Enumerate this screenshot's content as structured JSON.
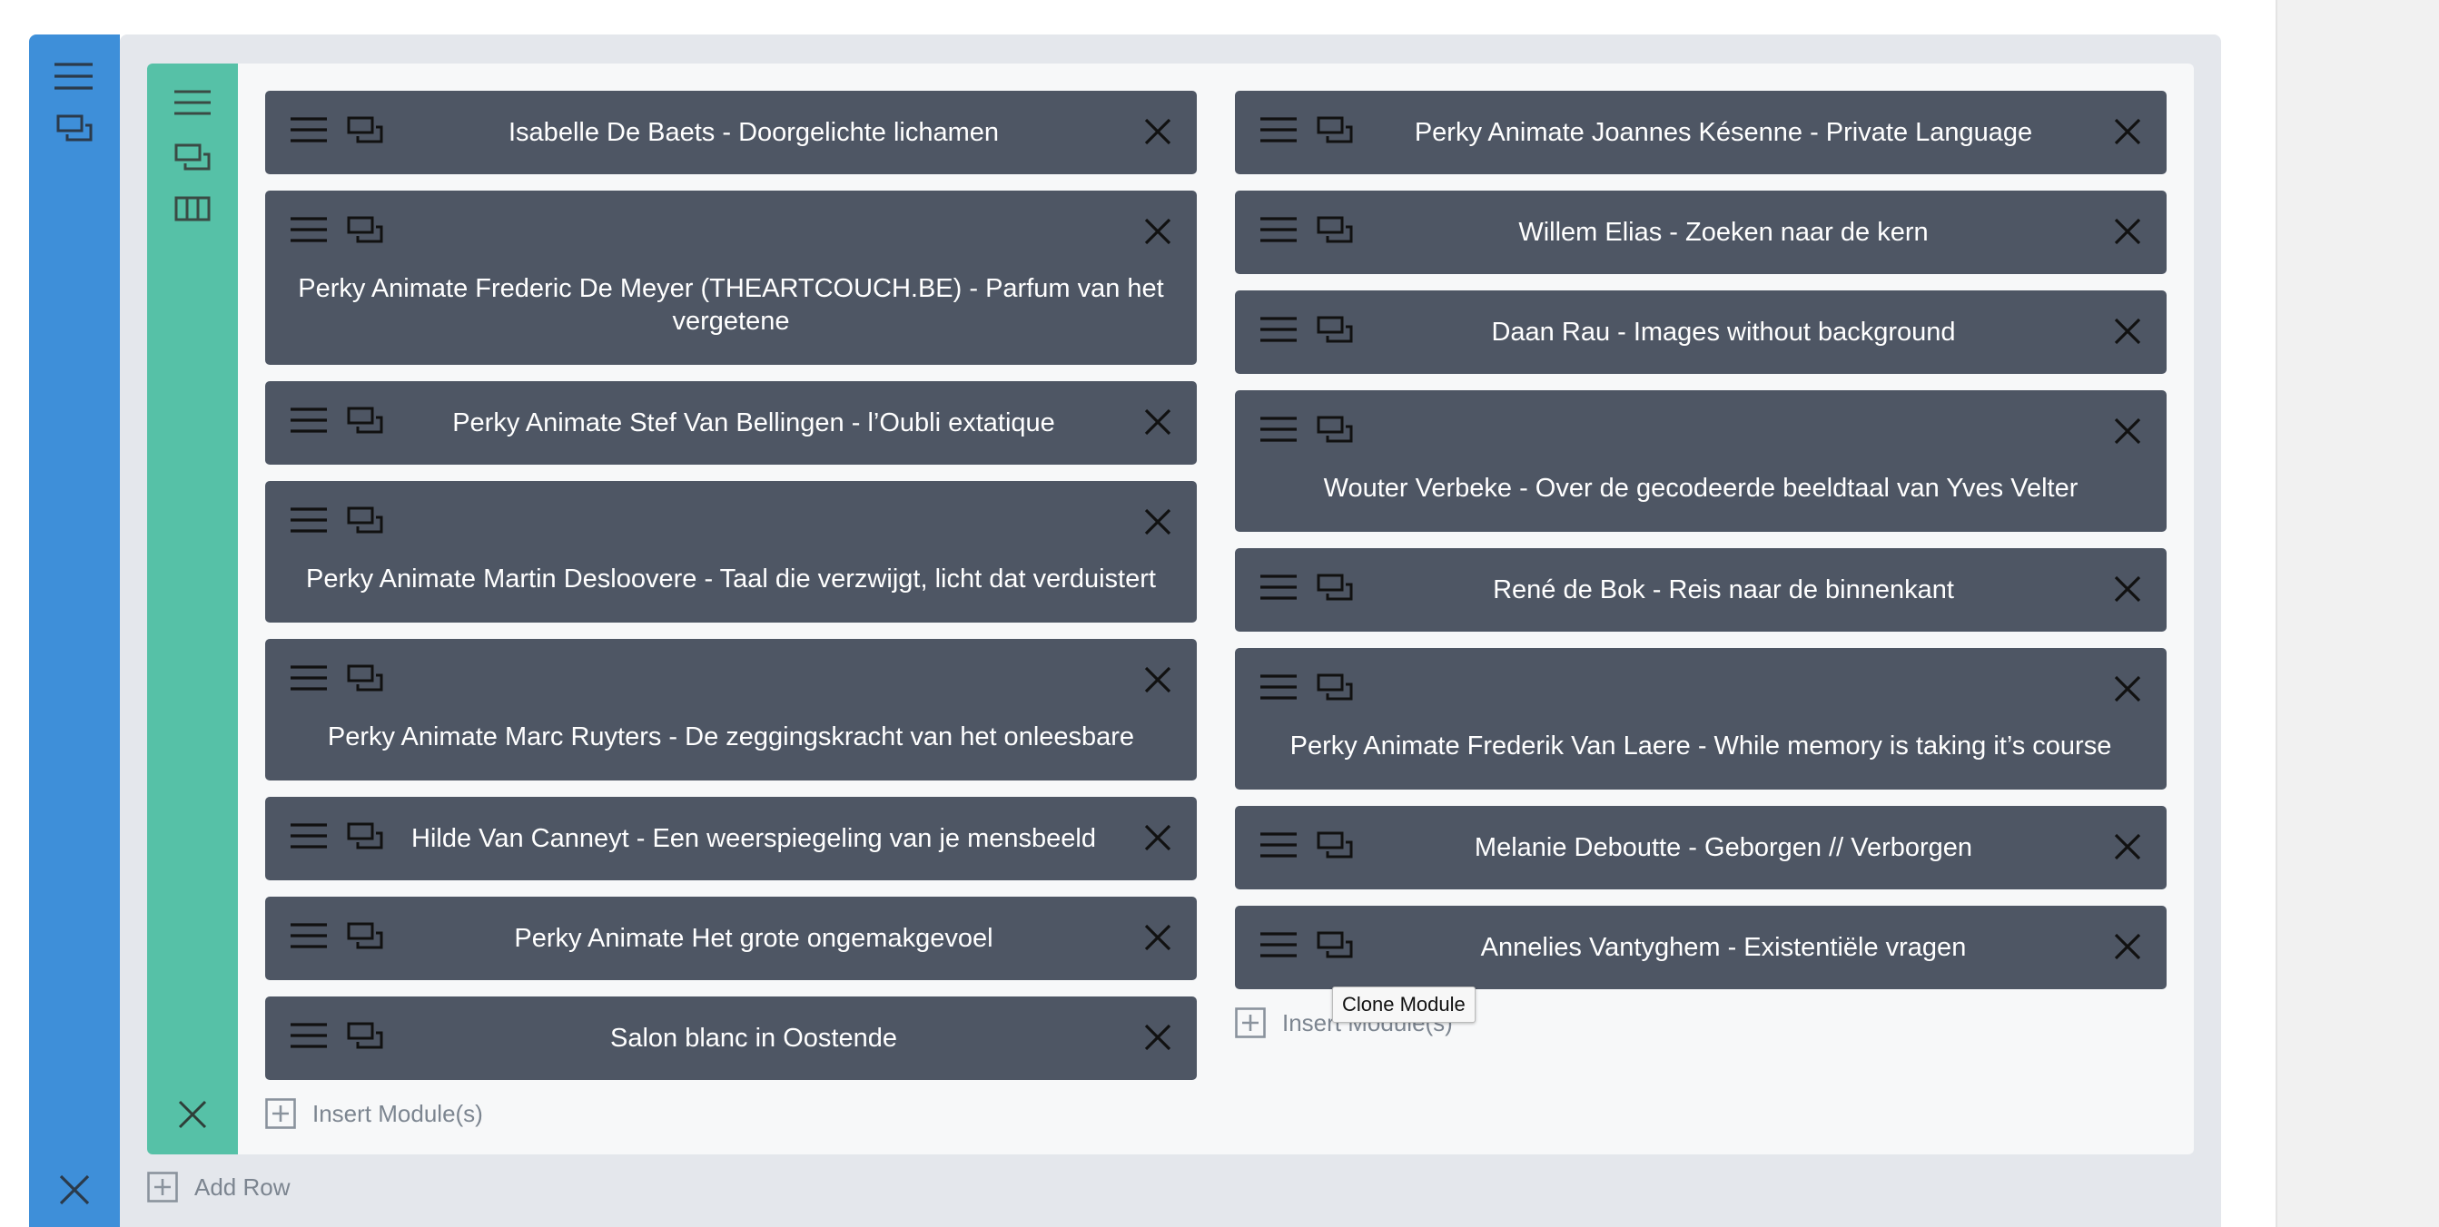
{
  "colors": {
    "section_accent": "#3e8fd9",
    "row_accent": "#56c1a7",
    "module_bg": "#4e5664",
    "module_text": "#ffffff",
    "muted_text": "#7c8590"
  },
  "section": {
    "icons": [
      "hamburger-icon",
      "clone-icon",
      "close-icon"
    ]
  },
  "row": {
    "icons": [
      "hamburger-icon",
      "clone-icon",
      "columns-icon",
      "close-icon"
    ]
  },
  "columns": [
    {
      "modules": [
        {
          "title": "Isabelle De Baets - Doorgelichte lichamen"
        },
        {
          "title": "Perky Animate Frederic De Meyer (THEARTCOUCH.BE) - Parfum van het vergetene"
        },
        {
          "title": "Perky Animate Stef Van Bellingen - l’Oubli extatique"
        },
        {
          "title": "Perky Animate Martin Desloovere - Taal die verzwijgt, licht dat verduistert"
        },
        {
          "title": "Perky Animate Marc Ruyters - De zeggingskracht van het onleesbare"
        },
        {
          "title": "Hilde Van Canneyt - Een weerspiegeling van je mensbeeld"
        },
        {
          "title": "Perky Animate Het grote ongemakgevoel"
        },
        {
          "title": "Salon blanc in Oostende"
        }
      ],
      "insert_label": "Insert Module(s)"
    },
    {
      "modules": [
        {
          "title": "Perky Animate Joannes Késenne - Private Language"
        },
        {
          "title": "Willem Elias - Zoeken naar de kern"
        },
        {
          "title": "Daan Rau - Images without background"
        },
        {
          "title": "Wouter Verbeke - Over de gecodeerde beeldtaal van Yves Velter"
        },
        {
          "title": "René de Bok - Reis naar de binnenkant"
        },
        {
          "title": "Perky Animate Frederik Van Laere - While memory is taking it’s course"
        },
        {
          "title": "Melanie Deboutte - Geborgen // Verborgen"
        },
        {
          "title": "Annelies Vantyghem - Existentiële vragen"
        }
      ],
      "insert_label": "Insert Module(s)"
    }
  ],
  "add_row_label": "Add Row",
  "tooltip": "Clone Module"
}
